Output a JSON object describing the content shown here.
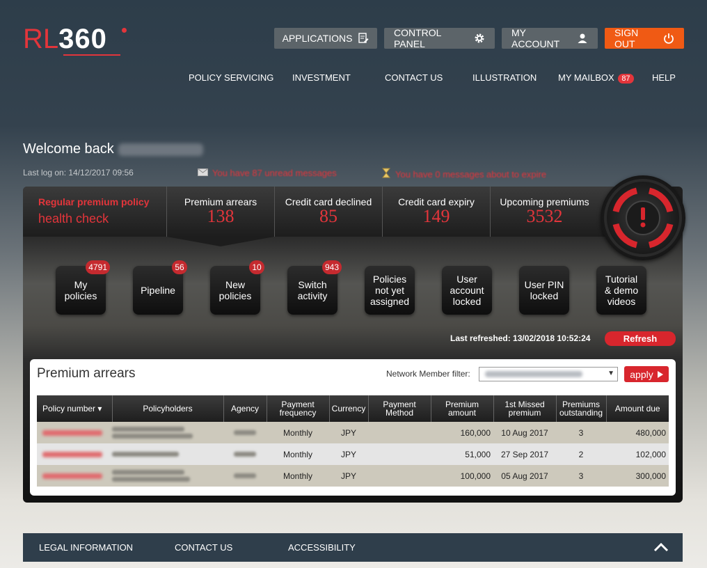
{
  "brand": {
    "logo_prefix": "RL",
    "logo_suffix": "360",
    "accent": "#e3353b"
  },
  "top_buttons": {
    "applications": "APPLICATIONS",
    "control_panel": "CONTROL PANEL",
    "my_account": "MY ACCOUNT",
    "sign_out": "SIGN OUT"
  },
  "nav": {
    "policy_servicing": "POLICY SERVICING",
    "investment": "INVESTMENT",
    "contact_us": "CONTACT US",
    "illustration": "ILLUSTRATION",
    "my_mailbox": "MY MAILBOX",
    "mailbox_count": "87",
    "help": "HELP"
  },
  "welcome": {
    "greeting": "Welcome back",
    "last_logon": "Last log on: 14/12/2017 09:56",
    "unread_msg": "You have 87 unread messages",
    "expire_msg": "You have 0 messages about to expire"
  },
  "health": {
    "title": "Regular premium policy",
    "subtitle": "health check",
    "cells": [
      {
        "label": "Premium arrears",
        "value": "138"
      },
      {
        "label": "Credit card declined",
        "value": "85"
      },
      {
        "label": "Credit card expiry",
        "value": "149"
      },
      {
        "label": "Upcoming premiums",
        "value": "3532"
      }
    ]
  },
  "tiles": [
    {
      "label": "My policies",
      "badge": "4791"
    },
    {
      "label": "Pipeline",
      "badge": "56"
    },
    {
      "label": "New policies",
      "badge": "10"
    },
    {
      "label": "Switch activity",
      "badge": "943"
    },
    {
      "label": "Policies not yet assigned",
      "badge": ""
    },
    {
      "label": "User account locked",
      "badge": ""
    },
    {
      "label": "User PIN locked",
      "badge": ""
    },
    {
      "label": "Tutorial & demo videos",
      "badge": ""
    }
  ],
  "refresh": {
    "last_refreshed": "Last refreshed: 13/02/2018 10:52:24",
    "button": "Refresh"
  },
  "arrears": {
    "title": "Premium arrears",
    "filter_label": "Network Member filter:",
    "apply": "apply",
    "columns": [
      "Policy number ▾",
      "Policyholders",
      "Agency",
      "Payment frequency",
      "Currency",
      "Payment Method",
      "Premium amount",
      "1st Missed premium",
      "Premiums outstanding",
      "Amount due"
    ],
    "rows": [
      {
        "frequency": "Monthly",
        "currency": "JPY",
        "method": "",
        "premium": "160,000",
        "missed": "10 Aug 2017",
        "outstanding": "3",
        "due": "480,000"
      },
      {
        "frequency": "Monthly",
        "currency": "JPY",
        "method": "",
        "premium": "51,000",
        "missed": "27 Sep 2017",
        "outstanding": "2",
        "due": "102,000"
      },
      {
        "frequency": "Monthly",
        "currency": "JPY",
        "method": "",
        "premium": "100,000",
        "missed": "05 Aug 2017",
        "outstanding": "3",
        "due": "300,000"
      }
    ]
  },
  "footer": {
    "legal": "LEGAL INFORMATION",
    "contact": "CONTACT US",
    "accessibility": "ACCESSIBILITY"
  }
}
